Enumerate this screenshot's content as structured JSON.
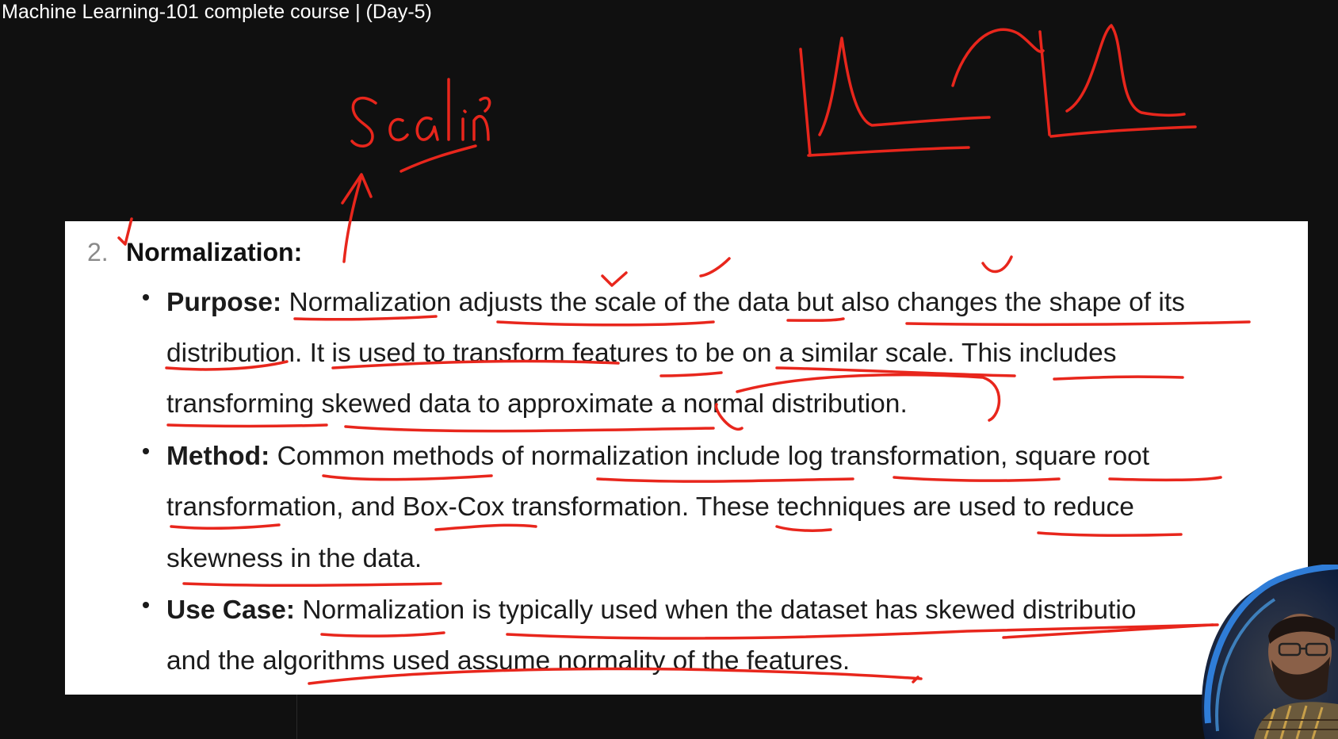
{
  "video": {
    "title": "Machine Learning-101 complete course | (Day-5)"
  },
  "slide": {
    "section_number": "2.",
    "section_title": "Normalization:",
    "bullets": [
      {
        "label": "Purpose:",
        "lines": [
          "Normalization adjusts the scale of the data but also changes the shape of its",
          "distribution. It is used to transform features to be on a similar scale. This includes",
          "transforming skewed data to approximate a normal distribution."
        ]
      },
      {
        "label": "Method:",
        "lines": [
          "Common methods of normalization include log transformation, square root",
          "transformation, and Box-Cox transformation. These techniques are used to reduce",
          "skewness in the data."
        ]
      },
      {
        "label": "Use Case:",
        "lines": [
          "Normalization is typically used when the dataset has skewed distributio",
          "and the algorithms used assume normality of the features."
        ]
      }
    ]
  },
  "annotations": {
    "handwritten_word": "Scaling",
    "ink_color": "#e8261c"
  },
  "colors": {
    "background": "#101010",
    "slide_background": "#ffffff",
    "text": "#1b1b1b"
  }
}
